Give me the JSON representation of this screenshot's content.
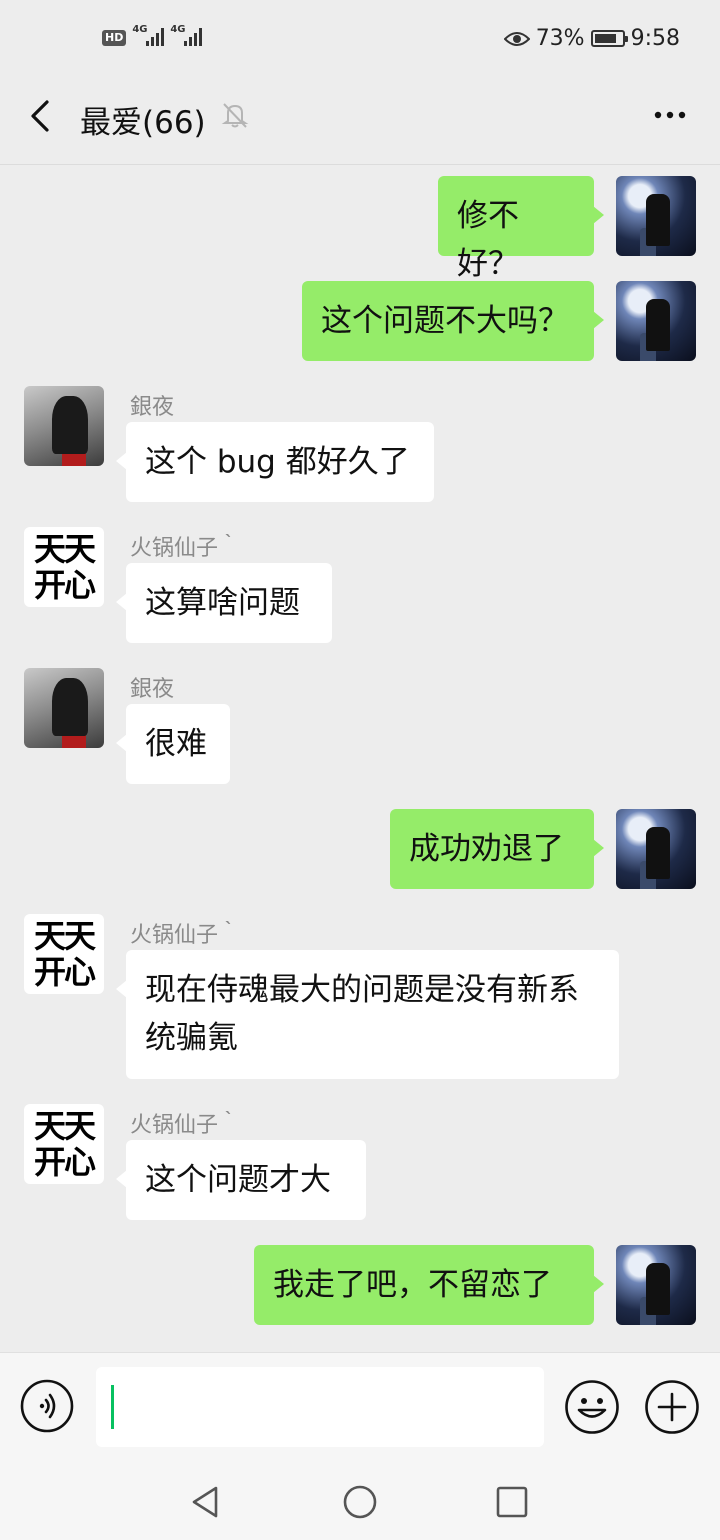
{
  "status_bar": {
    "hd": "HD",
    "net1": "4G",
    "net2": "4G",
    "battery_pct": "73%",
    "time": "9:58"
  },
  "header": {
    "title": "最爱(66)"
  },
  "messages": [
    {
      "side": "me",
      "text": "修不好？"
    },
    {
      "side": "me",
      "text": "这个问题不大吗？"
    },
    {
      "side": "other",
      "sender": "銀夜",
      "text": "这个 bug 都好久了"
    },
    {
      "side": "other",
      "sender": "火锅仙子｀",
      "text": "这算啥问题"
    },
    {
      "side": "other",
      "sender": "銀夜",
      "text": "很难"
    },
    {
      "side": "me",
      "text": "成功劝退了"
    },
    {
      "side": "other",
      "sender": "火锅仙子｀",
      "text": "现在侍魂最大的问题是没有新系统骗氪"
    },
    {
      "side": "other",
      "sender": "火锅仙子｀",
      "text": "这个问题才大"
    },
    {
      "side": "me",
      "text": "我走了吧，不留恋了"
    }
  ],
  "avatar_text": {
    "huo": "天天开心"
  },
  "input": {
    "value": ""
  },
  "colors": {
    "my_bubble": "#95ec69",
    "other_bubble": "#ffffff",
    "background": "#ededed",
    "caret": "#07c160"
  },
  "icons": [
    "back-arrow-icon",
    "mute-bell-icon",
    "more-icon",
    "voice-icon",
    "emoji-icon",
    "plus-icon",
    "nav-back-icon",
    "nav-home-icon",
    "nav-recent-icon"
  ]
}
